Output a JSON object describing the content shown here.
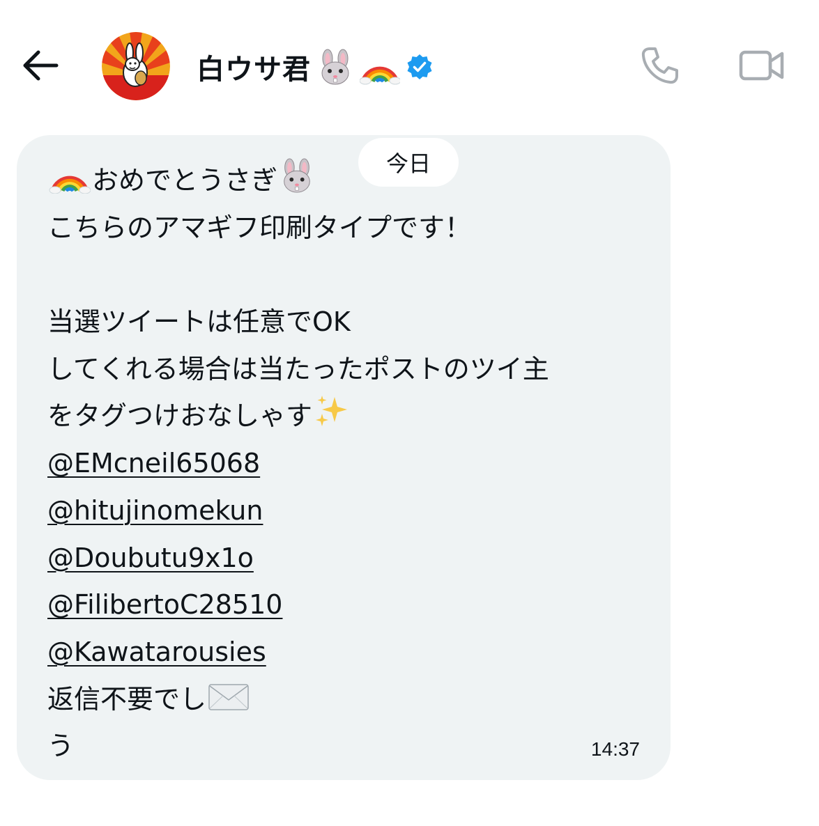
{
  "header": {
    "back_icon": "arrow-left-icon",
    "avatar_icon": "rabbit-avatar",
    "name": "白ウサ君",
    "name_emojis": [
      "rabbit-face-emoji",
      "rainbow-emoji"
    ],
    "verified_icon": "verified-badge-icon",
    "call_icon": "phone-icon",
    "video_icon": "video-camera-icon"
  },
  "date_separator": "今日",
  "message": {
    "line1_text": "おめでとうさぎ",
    "line2": "こちらのアマギフ印刷タイプです！",
    "line4": "当選ツイートは任意でOK",
    "line5": "してくれる場合は当たったポストのツイ主",
    "line6_text": "をタグつけおなしゃす",
    "mentions": [
      "@EMcneil65068",
      "@hitujinomekun",
      "@Doubutu9x1o",
      "@FilibertoC28510",
      "@Kawatarousies"
    ],
    "line12_text": "返信不要でし",
    "line13": "う",
    "time": "14:37"
  },
  "colors": {
    "bubble_bg": "#eff3f4",
    "text": "#0f1419",
    "icon_gray": "#a8adb2",
    "verified_blue": "#1d9bf0"
  }
}
